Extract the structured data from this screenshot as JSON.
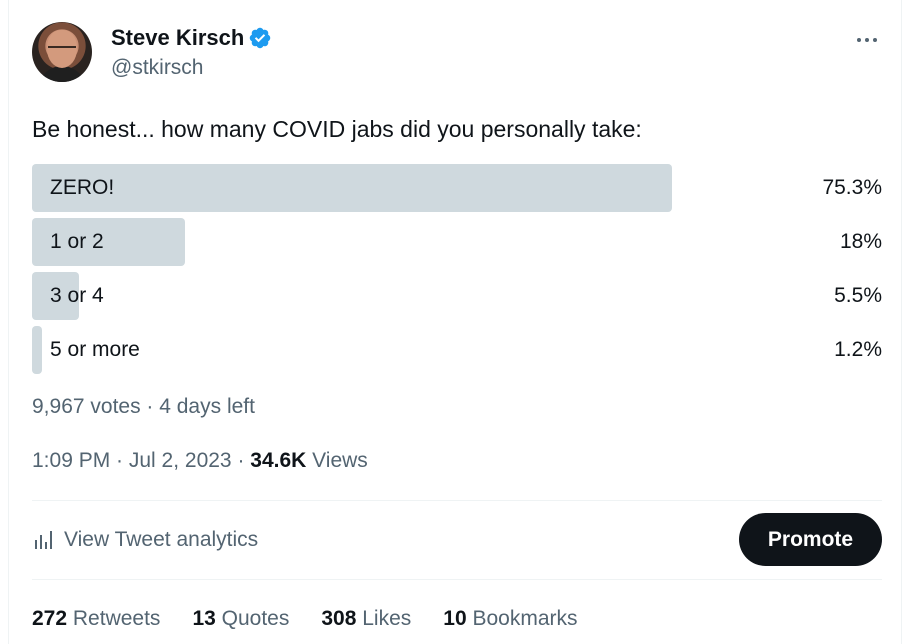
{
  "author": {
    "name": "Steve Kirsch",
    "handle": "@stkirsch",
    "verified_color": "#1d9bf0"
  },
  "tweet": {
    "text": "Be honest... how many COVID jabs did you personally take:"
  },
  "poll": {
    "options": [
      {
        "label": "ZERO!",
        "percent_text": "75.3%",
        "percent": 75.3
      },
      {
        "label": "1 or 2",
        "percent_text": "18%",
        "percent": 18
      },
      {
        "label": "3 or 4",
        "percent_text": "5.5%",
        "percent": 5.5
      },
      {
        "label": "5 or more",
        "percent_text": "1.2%",
        "percent": 1.2
      }
    ],
    "meta": "9,967 votes · 4 days left"
  },
  "timestamp": {
    "time_date": "1:09 PM · Jul 2, 2023 · ",
    "views_count": "34.6K",
    "views_label": " Views"
  },
  "analytics": {
    "label": "View Tweet analytics",
    "icon": "bar-chart-icon"
  },
  "promote": {
    "label": "Promote"
  },
  "stats": [
    {
      "count": "272",
      "label": "Retweets"
    },
    {
      "count": "13",
      "label": "Quotes"
    },
    {
      "count": "308",
      "label": "Likes"
    },
    {
      "count": "10",
      "label": "Bookmarks"
    }
  ],
  "colors": {
    "poll_fill": "#cfd9de",
    "secondary_text": "#536471",
    "primary_text": "#0f1419",
    "button_bg": "#0f1419"
  }
}
